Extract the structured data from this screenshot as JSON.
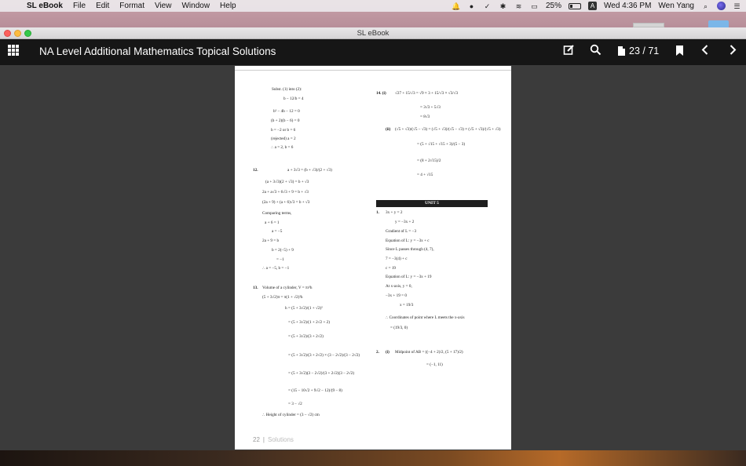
{
  "menubar": {
    "app_name": "SL eBook",
    "menus": [
      "File",
      "Edit",
      "Format",
      "View",
      "Window",
      "Help"
    ],
    "battery_percent": "25%",
    "battery_level": 0.25,
    "clock": "Wed 4:36 PM",
    "user": "Wen Yang",
    "input_source": "A"
  },
  "window": {
    "title": "SL eBook"
  },
  "toolbar": {
    "book_title": "NA Level Additional Mathematics Topical Solutions",
    "page_indicator": "23 / 71"
  },
  "page": {
    "left_column": [
      "Subst. (1) into (2):",
      "b − 12/b = 4",
      "b² − 4b − 12 = 0",
      "(b + 2)(b − 6) = 0",
      "b = −2      or      b = 6",
      "(rejected)           a = 2",
      "∴ a = 2, b = 6",
      "12.",
      "a + 3√3 = (b + √3)/(2 + √3)",
      "(a + 3√3)(2 + √3) = b + √3",
      "2a + a√3 + 6√3 + 9 = b + √3",
      "(2a + 9) + (a + 6)√3 = b + √3",
      "Comparing terms,",
      "a + 6 = 1",
      "a = −5",
      "2a + 9 = b",
      "b = 2(−5) + 9",
      "= −1",
      "∴ a = −5, b = −1",
      "13.",
      "Volume of a cylinder, V = πr²h",
      "(5 + 3√2)π = π(1 + √2)²h",
      "h = (5 + 3√2)/(1 + √2)²",
      "= (5 + 3√2)/(1 + 2√2 + 2)",
      "= (5 + 3√2)/(3 + 2√2)",
      "= (5 + 3√2)/(3 + 2√2) × (3 − 2√2)/(3 − 2√2)",
      "= (5 + 3√2)(3 − 2√2)/(3 + 2√2)(3 − 2√2)",
      "= (15 − 10√2 + 9√2 − 12)/(9 − 8)",
      "= 3 − √2",
      "∴ Height of cylinder = (3 − √2) cm"
    ],
    "right_column": [
      "14. (i)",
      "√27 + 15/√3 = √9 × 3 + 15/√3 × √3/√3",
      "= 3√3 + 5√3",
      "= 8√3",
      "(ii)",
      "(√5 + √3)/(√5 − √3) = (√5 + √3)/(√5 − √3) × (√5 + √3)/(√5 + √3)",
      "= (5 + √15 + √15 + 3)/(5 − 3)",
      "= (8 + 2√15)/2",
      "= 4 + √15",
      "UNIT 5",
      "1.",
      "3x + y = 2",
      "y = −3x + 2",
      "Gradient of L = −3",
      "Equation of L:  y = −3x + c",
      "Since L passes through (4, 7),",
      "7 = −3(4) + c",
      "c = 19",
      "Equation of L:  y = −3x + 19",
      "At x-axis, y = 0,",
      "−3x + 19 = 0",
      "x = 19/3",
      "∴ Coordinates of point where L meets the x-axis",
      "= (19/3, 0)",
      "2.",
      "(i)",
      "Midpoint of AB = ((−4 + 2)/2, (5 + 17)/2)",
      "= (−1, 11)"
    ],
    "footer_number": "22",
    "footer_label": "Solutions"
  }
}
